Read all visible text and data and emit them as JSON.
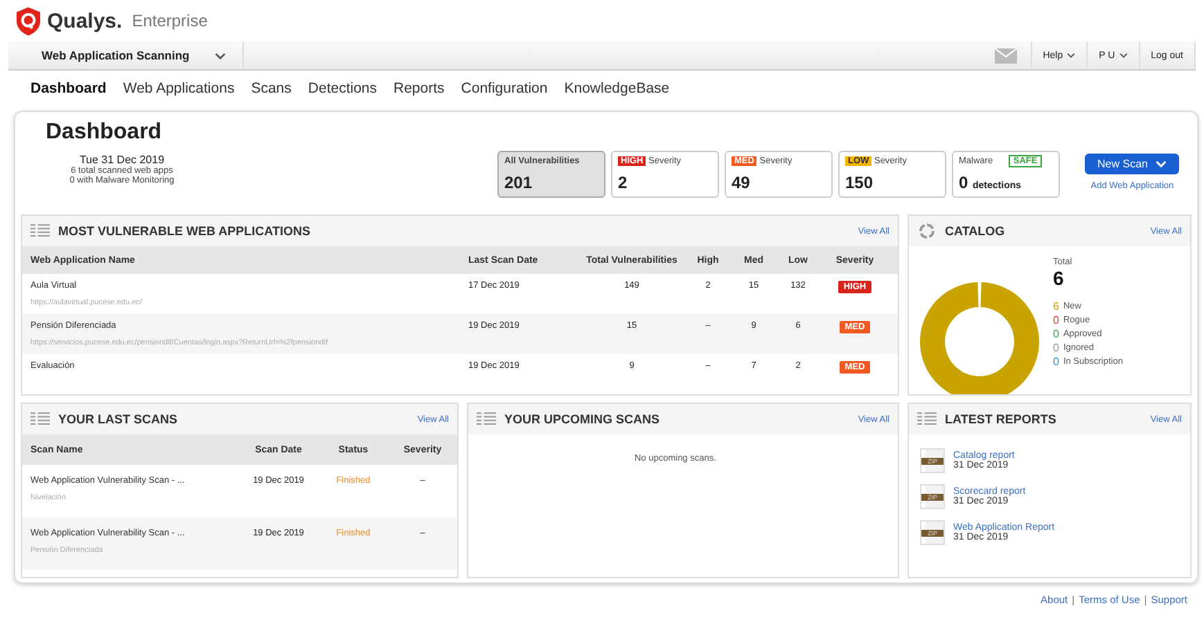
{
  "brand": {
    "name": "Qualys.",
    "edition": "Enterprise"
  },
  "module": "Web Application Scanning",
  "top_menu": [
    {
      "label": "Help",
      "kind": "dropdown"
    },
    {
      "label": "P U",
      "kind": "dropdown"
    },
    {
      "label": "Log out",
      "kind": "plain"
    }
  ],
  "tabs": [
    {
      "label": "Dashboard",
      "selected": true
    },
    {
      "label": "Web Applications",
      "selected": false
    },
    {
      "label": "Scans",
      "selected": false
    },
    {
      "label": "Detections",
      "selected": false
    },
    {
      "label": "Reports",
      "selected": false
    },
    {
      "label": "Configuration",
      "selected": false
    },
    {
      "label": "KnowledgeBase",
      "selected": false
    }
  ],
  "page_title": "Dashboard",
  "summary": {
    "date": "Tue 31 Dec 2019",
    "lines": [
      "6 total scanned web apps",
      "0 with Malware Monitoring"
    ]
  },
  "counters": [
    {
      "kind": "all",
      "label": "All Vulnerabilities",
      "value": "201",
      "selected": true
    },
    {
      "kind": "high",
      "tag": "HIGH",
      "label": "Severity",
      "value": "2",
      "selected": false
    },
    {
      "kind": "med",
      "tag": "MED",
      "label": "Severity",
      "value": "49",
      "selected": false
    },
    {
      "kind": "low",
      "tag": "LOW",
      "label": "Severity",
      "value": "150",
      "selected": false
    },
    {
      "kind": "malware",
      "label": "Malware",
      "tag": "SAFE",
      "value": "0",
      "unit": "detections",
      "selected": false
    }
  ],
  "new_scan": {
    "label": "New Scan",
    "link": "Add Web Application"
  },
  "most_vulnerable": {
    "title": "MOST VULNERABLE WEB APPLICATIONS",
    "view_all": "View All",
    "columns": [
      "Web Application Name",
      "Last Scan Date",
      "Total Vulnerabilities",
      "High",
      "Med",
      "Low",
      "Severity"
    ],
    "rows": [
      {
        "name": "Aula Virtual",
        "url": "https://aulavirtual.pucese.edu.ec/",
        "date": "17 Dec 2019",
        "total": "149",
        "high": "2",
        "med": "15",
        "low": "132",
        "severity": "HIGH",
        "kind": "high"
      },
      {
        "name": "Pensión Diferenciada",
        "url": "https://servicios.pucese.edu.ec/pensiondif/Cuentas/login.aspx?ReturnUrl=%2fpensiondif",
        "date": "19 Dec 2019",
        "total": "15",
        "high": "–",
        "med": "9",
        "low": "6",
        "severity": "MED",
        "kind": "med"
      },
      {
        "name": "Evaluación",
        "date": "19 Dec 2019",
        "total": "9",
        "high": "–",
        "med": "7",
        "low": "2",
        "severity": "MED",
        "kind": "med"
      }
    ]
  },
  "catalog": {
    "title": "CATALOG",
    "view_all": "View All",
    "total_label": "Total",
    "total": "6",
    "legend": [
      {
        "count": "6",
        "label": "New",
        "color": "#c9a400"
      },
      {
        "count": "0",
        "label": "Rogue",
        "color": "#e8383d"
      },
      {
        "count": "0",
        "label": "Approved",
        "color": "#3aa53a"
      },
      {
        "count": "0",
        "label": "Ignored",
        "color": "#999999"
      },
      {
        "count": "0",
        "label": "In Subscription",
        "color": "#2a8fd6"
      }
    ]
  },
  "last_scans": {
    "title": "YOUR LAST SCANS",
    "view_all": "View All",
    "columns": [
      "Scan Name",
      "Scan Date",
      "Status",
      "Severity"
    ],
    "rows": [
      {
        "name": "Web Application Vulnerability Scan - ...",
        "app": "Nivelación",
        "date": "19 Dec 2019",
        "status": "Finished",
        "severity": "–"
      },
      {
        "name": "Web Application Vulnerability Scan - ...",
        "app": "Pensión Diferenciada",
        "date": "19 Dec 2019",
        "status": "Finished",
        "severity": "–"
      }
    ]
  },
  "upcoming_scans": {
    "title": "YOUR UPCOMING SCANS",
    "view_all": "View All",
    "empty": "No upcoming scans."
  },
  "latest_reports": {
    "title": "LATEST REPORTS",
    "view_all": "View All",
    "items": [
      {
        "badge": "ZIP",
        "name": "Catalog report",
        "date": "31 Dec 2019"
      },
      {
        "badge": "ZIP",
        "name": "Scorecard report",
        "date": "31 Dec 2019"
      },
      {
        "badge": "ZIP",
        "name": "Web Application Report",
        "date": "31 Dec 2019"
      }
    ]
  },
  "footer": {
    "separator": "|",
    "links": [
      "About",
      "Terms of Use",
      "Support"
    ]
  }
}
